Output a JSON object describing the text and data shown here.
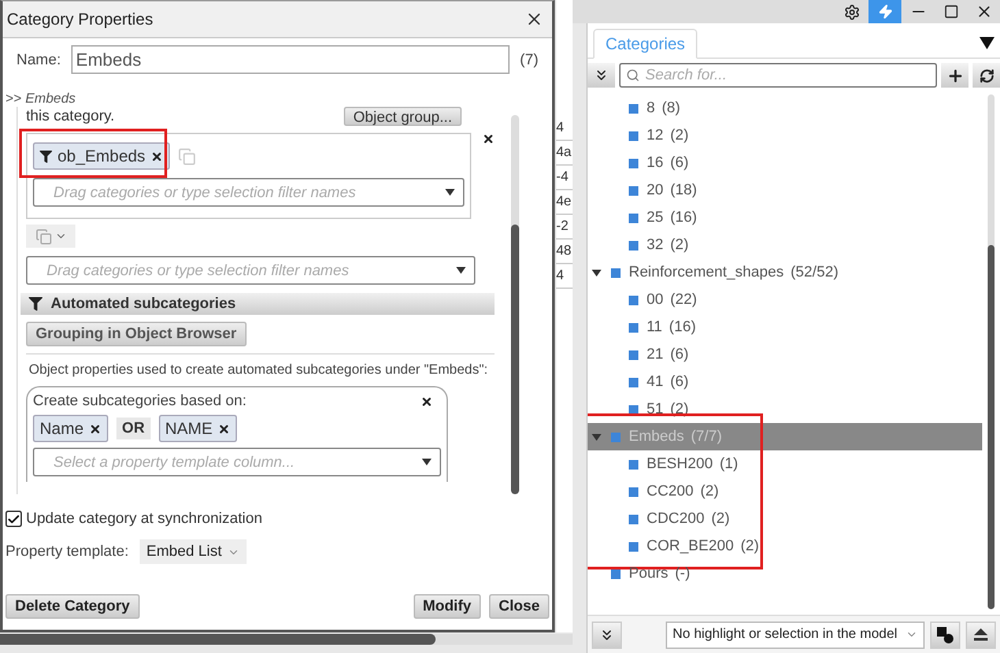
{
  "dialog": {
    "title": "Category Properties",
    "name_label": "Name:",
    "name_value": "Embeds",
    "name_count": "(7)",
    "breadcrumb": ">> *Embeds*",
    "scroll_content": {
      "cut_text": "this category.",
      "object_group_button": "Object group...",
      "filter_chips": [
        {
          "label": "ob_Embeds",
          "highlighted": true
        }
      ],
      "filter_placeholder": "Drag categories or type selection filter names",
      "second_filter_placeholder": "Drag categories or type selection filter names",
      "section_title": "Automated subcategories",
      "grouping_button": "Grouping in Object Browser",
      "description": "Object properties used to create automated subcategories under \"Embeds\":",
      "subcategory_box": {
        "title": "Create subcategories based on:",
        "chips": [
          {
            "kind": "chip",
            "label": "Name"
          },
          {
            "kind": "operator",
            "label": "OR"
          },
          {
            "kind": "chip",
            "label": "NAME"
          }
        ],
        "placeholder": "Select a property template column..."
      }
    },
    "update_checkbox": {
      "label": "Update category at synchronization",
      "checked": true
    },
    "property_template": {
      "label": "Property template:",
      "value": "Embed List"
    },
    "buttons": {
      "left": [
        "Delete Category"
      ],
      "right": [
        "Modify",
        "Close"
      ]
    }
  },
  "background_cells": [
    "4",
    "4a",
    "-4",
    "4e",
    "-2",
    "48",
    "4"
  ],
  "panel": {
    "tabs": [
      {
        "label": "Categories",
        "selected": true
      }
    ],
    "search": {
      "placeholder": "Search for..."
    },
    "tree_continued": [
      {
        "label": "8",
        "count": "(8)"
      },
      {
        "label": "12",
        "count": "(2)"
      },
      {
        "label": "16",
        "count": "(6)"
      },
      {
        "label": "20",
        "count": "(18)"
      },
      {
        "label": "25",
        "count": "(16)"
      },
      {
        "label": "32",
        "count": "(2)"
      }
    ],
    "tree": [
      {
        "label": "Reinforcement_shapes",
        "count": "(52/52)",
        "expanded": true,
        "selected": false,
        "children": [
          {
            "label": "00",
            "count": "(22)"
          },
          {
            "label": "11",
            "count": "(16)"
          },
          {
            "label": "21",
            "count": "(6)"
          },
          {
            "label": "41",
            "count": "(6)"
          },
          {
            "label": "51",
            "count": "(2)"
          }
        ]
      },
      {
        "label": "Embeds",
        "count": "(7/7)",
        "expanded": true,
        "selected": true,
        "highlighted": true,
        "children": [
          {
            "label": "BESH200",
            "count": "(1)"
          },
          {
            "label": "CC200",
            "count": "(2)"
          },
          {
            "label": "CDC200",
            "count": "(2)"
          },
          {
            "label": "COR_BE200",
            "count": "(2)"
          }
        ]
      },
      {
        "label": "Pours",
        "count": "(-)",
        "selected": false
      }
    ],
    "highlight_select": "No highlight or selection in the model"
  }
}
